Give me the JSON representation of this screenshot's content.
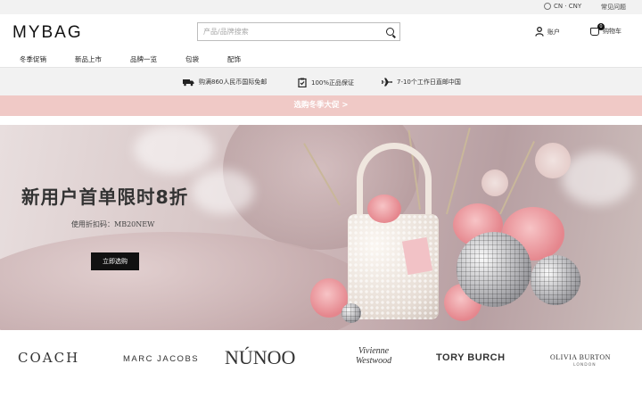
{
  "topbar": {
    "locale": "CN · CNY",
    "help": "常见问题",
    "icon": "globe-icon"
  },
  "header": {
    "logo": "MYBAG",
    "search_placeholder": "产品/品牌搜索",
    "account_label": "账户",
    "cart_label": "购物车",
    "cart_count": "0"
  },
  "nav": {
    "items": [
      "冬季促销",
      "新品上市",
      "品牌一览",
      "包袋",
      "配饰"
    ]
  },
  "usp": {
    "items": [
      {
        "icon": "truck-icon",
        "text": "购满860人民币国际免邮"
      },
      {
        "icon": "clipboard-check-icon",
        "text": "100%正品保证"
      },
      {
        "icon": "airplane-icon",
        "text": "7-10个工作日直邮中国"
      }
    ]
  },
  "promo": {
    "text": "选购冬季大促 >"
  },
  "hero": {
    "headline": "新用户首单限时8折",
    "code_text": "使用折扣码：MB20NEW",
    "cta": "立即选购"
  },
  "brands": {
    "items": [
      "COACH",
      "MARC JACOBS",
      "NÚNOO",
      "Vivienne Westwood",
      "TORY BURCH",
      "OLIVIA BURTON"
    ],
    "sub_olivia": "LONDON"
  },
  "colors": {
    "promo_bg": "#f0c9c6",
    "cta_bg": "#111111",
    "topbar_bg": "#f2f2f2"
  }
}
